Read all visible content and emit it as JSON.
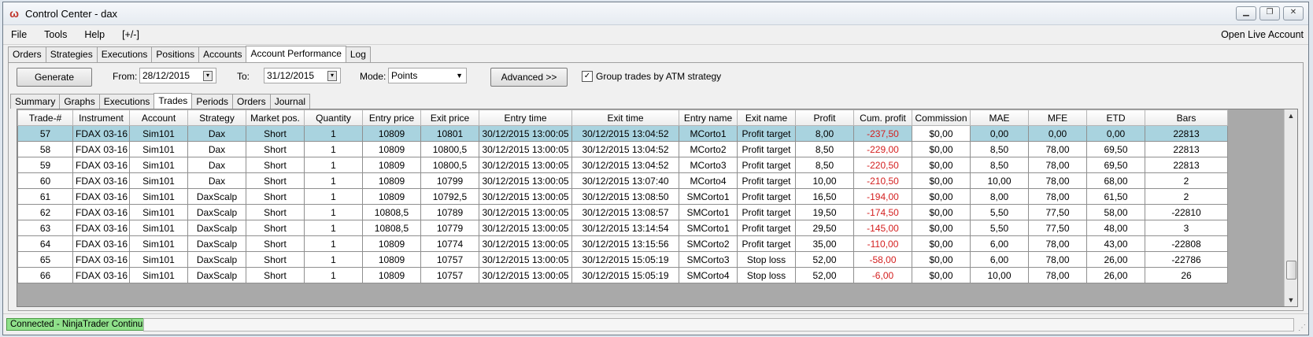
{
  "window": {
    "title": "Control Center - dax",
    "icon": "ninjatrader-logo-icon",
    "buttons": [
      "minimize-icon",
      "restore-icon",
      "close-icon"
    ]
  },
  "menu": {
    "items": [
      "File",
      "Tools",
      "Help",
      "[+/-]"
    ],
    "right": "Open Live Account"
  },
  "tabs": [
    "Orders",
    "Strategies",
    "Executions",
    "Positions",
    "Accounts",
    "Account Performance",
    "Log"
  ],
  "active_tab": "Account Performance",
  "controls": {
    "generate": "Generate",
    "from_label": "From:",
    "from_value": "28/12/2015",
    "to_label": "To:",
    "to_value": "31/12/2015",
    "mode_label": "Mode:",
    "mode_value": "Points",
    "advanced": "Advanced >>",
    "group_label": "Group trades by ATM strategy",
    "group_checked": true
  },
  "subtabs": [
    "Summary",
    "Graphs",
    "Executions",
    "Trades",
    "Periods",
    "Orders",
    "Journal"
  ],
  "active_subtab": "Trades",
  "grid": {
    "columns": [
      "Trade-#",
      "Instrument",
      "Account",
      "Strategy",
      "Market pos.",
      "Quantity",
      "Entry price",
      "Exit price",
      "Entry time",
      "Exit time",
      "Entry name",
      "Exit name",
      "Profit",
      "Cum. profit",
      "Commission",
      "MAE",
      "MFE",
      "ETD",
      "Bars"
    ],
    "rows": [
      [
        "57",
        "FDAX 03-16",
        "Sim101",
        "Dax",
        "Short",
        "1",
        "10809",
        "10801",
        "30/12/2015 13:00:05",
        "30/12/2015 13:04:52",
        "MCorto1",
        "Profit target",
        "8,00",
        "-237,50",
        "$0,00",
        "0,00",
        "0,00",
        "0,00",
        "22813"
      ],
      [
        "58",
        "FDAX 03-16",
        "Sim101",
        "Dax",
        "Short",
        "1",
        "10809",
        "10800,5",
        "30/12/2015 13:00:05",
        "30/12/2015 13:04:52",
        "MCorto2",
        "Profit target",
        "8,50",
        "-229,00",
        "$0,00",
        "8,50",
        "78,00",
        "69,50",
        "22813"
      ],
      [
        "59",
        "FDAX 03-16",
        "Sim101",
        "Dax",
        "Short",
        "1",
        "10809",
        "10800,5",
        "30/12/2015 13:00:05",
        "30/12/2015 13:04:52",
        "MCorto3",
        "Profit target",
        "8,50",
        "-220,50",
        "$0,00",
        "8,50",
        "78,00",
        "69,50",
        "22813"
      ],
      [
        "60",
        "FDAX 03-16",
        "Sim101",
        "Dax",
        "Short",
        "1",
        "10809",
        "10799",
        "30/12/2015 13:00:05",
        "30/12/2015 13:07:40",
        "MCorto4",
        "Profit target",
        "10,00",
        "-210,50",
        "$0,00",
        "10,00",
        "78,00",
        "68,00",
        "2"
      ],
      [
        "61",
        "FDAX 03-16",
        "Sim101",
        "DaxScalp",
        "Short",
        "1",
        "10809",
        "10792,5",
        "30/12/2015 13:00:05",
        "30/12/2015 13:08:50",
        "SMCorto1",
        "Profit target",
        "16,50",
        "-194,00",
        "$0,00",
        "8,00",
        "78,00",
        "61,50",
        "2"
      ],
      [
        "62",
        "FDAX 03-16",
        "Sim101",
        "DaxScalp",
        "Short",
        "1",
        "10808,5",
        "10789",
        "30/12/2015 13:00:05",
        "30/12/2015 13:08:57",
        "SMCorto1",
        "Profit target",
        "19,50",
        "-174,50",
        "$0,00",
        "5,50",
        "77,50",
        "58,00",
        "-22810"
      ],
      [
        "63",
        "FDAX 03-16",
        "Sim101",
        "DaxScalp",
        "Short",
        "1",
        "10808,5",
        "10779",
        "30/12/2015 13:00:05",
        "30/12/2015 13:14:54",
        "SMCorto1",
        "Profit target",
        "29,50",
        "-145,00",
        "$0,00",
        "5,50",
        "77,50",
        "48,00",
        "3"
      ],
      [
        "64",
        "FDAX 03-16",
        "Sim101",
        "DaxScalp",
        "Short",
        "1",
        "10809",
        "10774",
        "30/12/2015 13:00:05",
        "30/12/2015 13:15:56",
        "SMCorto2",
        "Profit target",
        "35,00",
        "-110,00",
        "$0,00",
        "6,00",
        "78,00",
        "43,00",
        "-22808"
      ],
      [
        "65",
        "FDAX 03-16",
        "Sim101",
        "DaxScalp",
        "Short",
        "1",
        "10809",
        "10757",
        "30/12/2015 13:00:05",
        "30/12/2015 15:05:19",
        "SMCorto3",
        "Stop loss",
        "52,00",
        "-58,00",
        "$0,00",
        "6,00",
        "78,00",
        "26,00",
        "-22786"
      ],
      [
        "66",
        "FDAX 03-16",
        "Sim101",
        "DaxScalp",
        "Short",
        "1",
        "10809",
        "10757",
        "30/12/2015 13:00:05",
        "30/12/2015 15:05:19",
        "SMCorto4",
        "Stop loss",
        "52,00",
        "-6,00",
        "$0,00",
        "10,00",
        "78,00",
        "26,00",
        "26"
      ]
    ],
    "selected_row": 0,
    "negative_color": "#d42020",
    "selected_color": "#a9d3df"
  },
  "status": {
    "connection": "Connected - NinjaTrader Continuum",
    "connection_color": "#8fe08a"
  }
}
